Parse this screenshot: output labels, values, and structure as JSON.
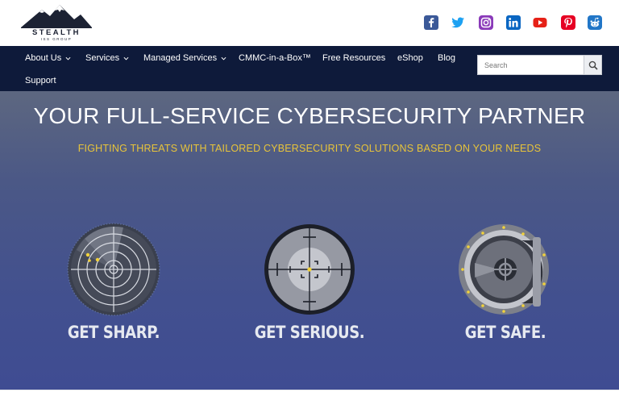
{
  "brand": {
    "name": "STEALTH",
    "sub": "ISS GROUP"
  },
  "social": [
    {
      "name": "facebook-icon",
      "color": "#3b5998"
    },
    {
      "name": "twitter-icon",
      "color": "#1da1f2"
    },
    {
      "name": "instagram-icon",
      "color": "#8a3ab9"
    },
    {
      "name": "linkedin-icon",
      "color": "#0a66c2"
    },
    {
      "name": "youtube-icon",
      "color": "#e62117"
    },
    {
      "name": "pinterest-icon",
      "color": "#e60023"
    },
    {
      "name": "reddit-icon",
      "color": "#2176c7"
    }
  ],
  "nav": {
    "about": "About Us",
    "services": "Services",
    "managed": "Managed Services",
    "cmmc": "CMMC-in-a-Box™",
    "free": "Free Resources",
    "eshop": "eShop",
    "blog": "Blog",
    "support": "Support"
  },
  "search": {
    "placeholder": "Search"
  },
  "hero": {
    "title": "YOUR FULL-SERVICE CYBERSECURITY PARTNER",
    "subtitle": "FIGHTING THREATS WITH TAILORED CYBERSECURITY SOLUTIONS BASED ON YOUR NEEDS"
  },
  "features": {
    "sharp": "GET SHARP.",
    "serious": "GET SERIOUS.",
    "safe": "GET SAFE."
  },
  "colors": {
    "navbar": "#0e1a3a",
    "accent": "#e8c43a"
  }
}
